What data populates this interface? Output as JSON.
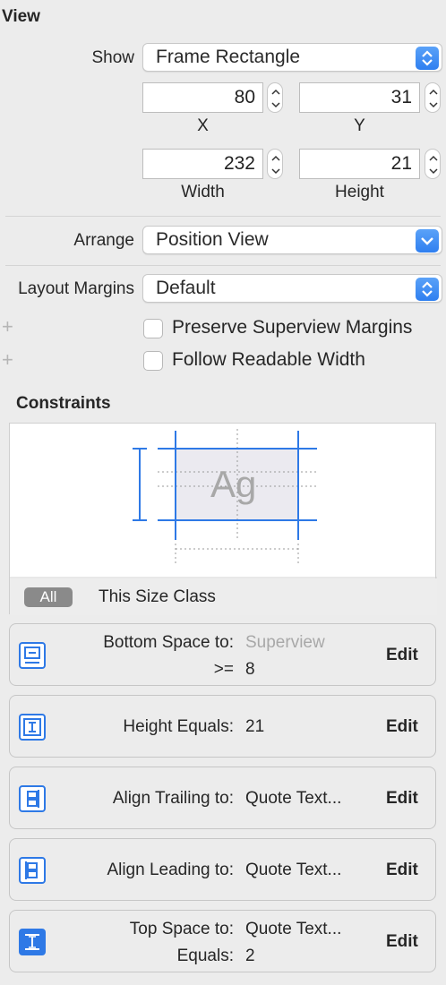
{
  "view": {
    "title": "View",
    "show_label": "Show",
    "show_value": "Frame Rectangle",
    "x_value": "80",
    "x_label": "X",
    "y_value": "31",
    "y_label": "Y",
    "width_value": "232",
    "width_label": "Width",
    "height_value": "21",
    "height_label": "Height",
    "arrange_label": "Arrange",
    "arrange_value": "Position View",
    "layout_margins_label": "Layout Margins",
    "layout_margins_value": "Default",
    "preserve_label": "Preserve Superview Margins",
    "follow_label": "Follow Readable Width",
    "plus": "+"
  },
  "constraints": {
    "title": "Constraints",
    "sample_text": "Ag",
    "all_label": "All",
    "size_class_label": "This Size Class",
    "edit_label": "Edit",
    "items": [
      {
        "label1": "Bottom Space to:",
        "value1": "Superview",
        "label2": ">=",
        "value2": "8",
        "icon": "bottom-space-icon"
      },
      {
        "label1": "Height Equals:",
        "value1": "21",
        "icon": "height-icon"
      },
      {
        "label1": "Align Trailing to:",
        "value1": "Quote Text...",
        "icon": "align-trailing-icon"
      },
      {
        "label1": "Align Leading to:",
        "value1": "Quote Text...",
        "icon": "align-leading-icon"
      },
      {
        "label1": "Top Space to:",
        "value1": "Quote Text...",
        "label2": "Equals:",
        "value2": "2",
        "icon": "top-space-icon"
      }
    ]
  },
  "colors": {
    "accent": "#2f7ff0",
    "constraint_blue": "#2e79e6",
    "background": "#ececec"
  }
}
